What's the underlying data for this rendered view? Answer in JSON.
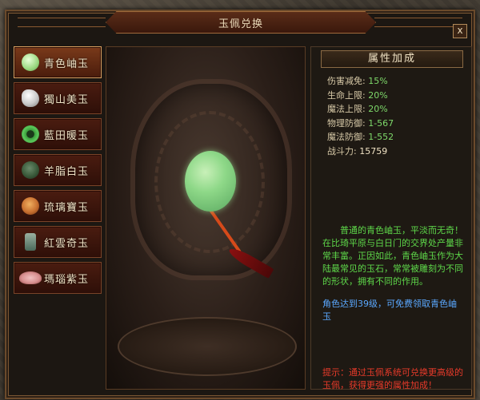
{
  "window": {
    "title": "玉佩兑换",
    "close": "x"
  },
  "jade_list": [
    {
      "label": "青色岫玉",
      "icon": "green-jade-icon",
      "color": "#b8e8a0",
      "selected": true
    },
    {
      "label": "獨山美玉",
      "icon": "white-swirl-jade-icon",
      "color": "#c8c8c8",
      "selected": false
    },
    {
      "label": "藍田暖玉",
      "icon": "green-ring-jade-icon",
      "color": "#3a9a3a",
      "selected": false
    },
    {
      "label": "羊脂白玉",
      "icon": "dark-jade-disc-icon",
      "color": "#3a5a3a",
      "selected": false
    },
    {
      "label": "琉璃寶玉",
      "icon": "amber-jade-icon",
      "color": "#c87030",
      "selected": false
    },
    {
      "label": "紅雲奇玉",
      "icon": "totem-jade-icon",
      "color": "#6a8a7a",
      "selected": false
    },
    {
      "label": "瑪瑙紫玉",
      "icon": "pink-lotus-jade-icon",
      "color": "#d89090",
      "selected": false
    }
  ],
  "attributes": {
    "header": "属性加成",
    "rows": [
      {
        "label": "伤害减免:",
        "value": "15%"
      },
      {
        "label": "生命上限:",
        "value": "20%"
      },
      {
        "label": "魔法上限:",
        "value": "20%"
      },
      {
        "label": "物理防御:",
        "value": "1-567"
      },
      {
        "label": "魔法防御:",
        "value": "1-552"
      },
      {
        "label": "战斗力:",
        "value": "15759"
      }
    ],
    "description": "普通的青色岫玉，平淡而无奇！在比琦平原与白日门的交界处产量非常丰富。正因如此，青色岫玉作为大陆最常见的玉石，常常被雕刻为不同的形状，拥有不同的作用。",
    "unlock": "角色达到39级，可免费领取青色岫玉",
    "tip": "提示：通过玉佩系统可兑换更高级的玉佩，获得更强的属性加成！"
  },
  "colors": {
    "frame": "#6b4a2b",
    "attr_value": "#7ed86a",
    "description": "#5ed84a",
    "unlock": "#5aa8ff",
    "tip": "#e83a2a"
  }
}
